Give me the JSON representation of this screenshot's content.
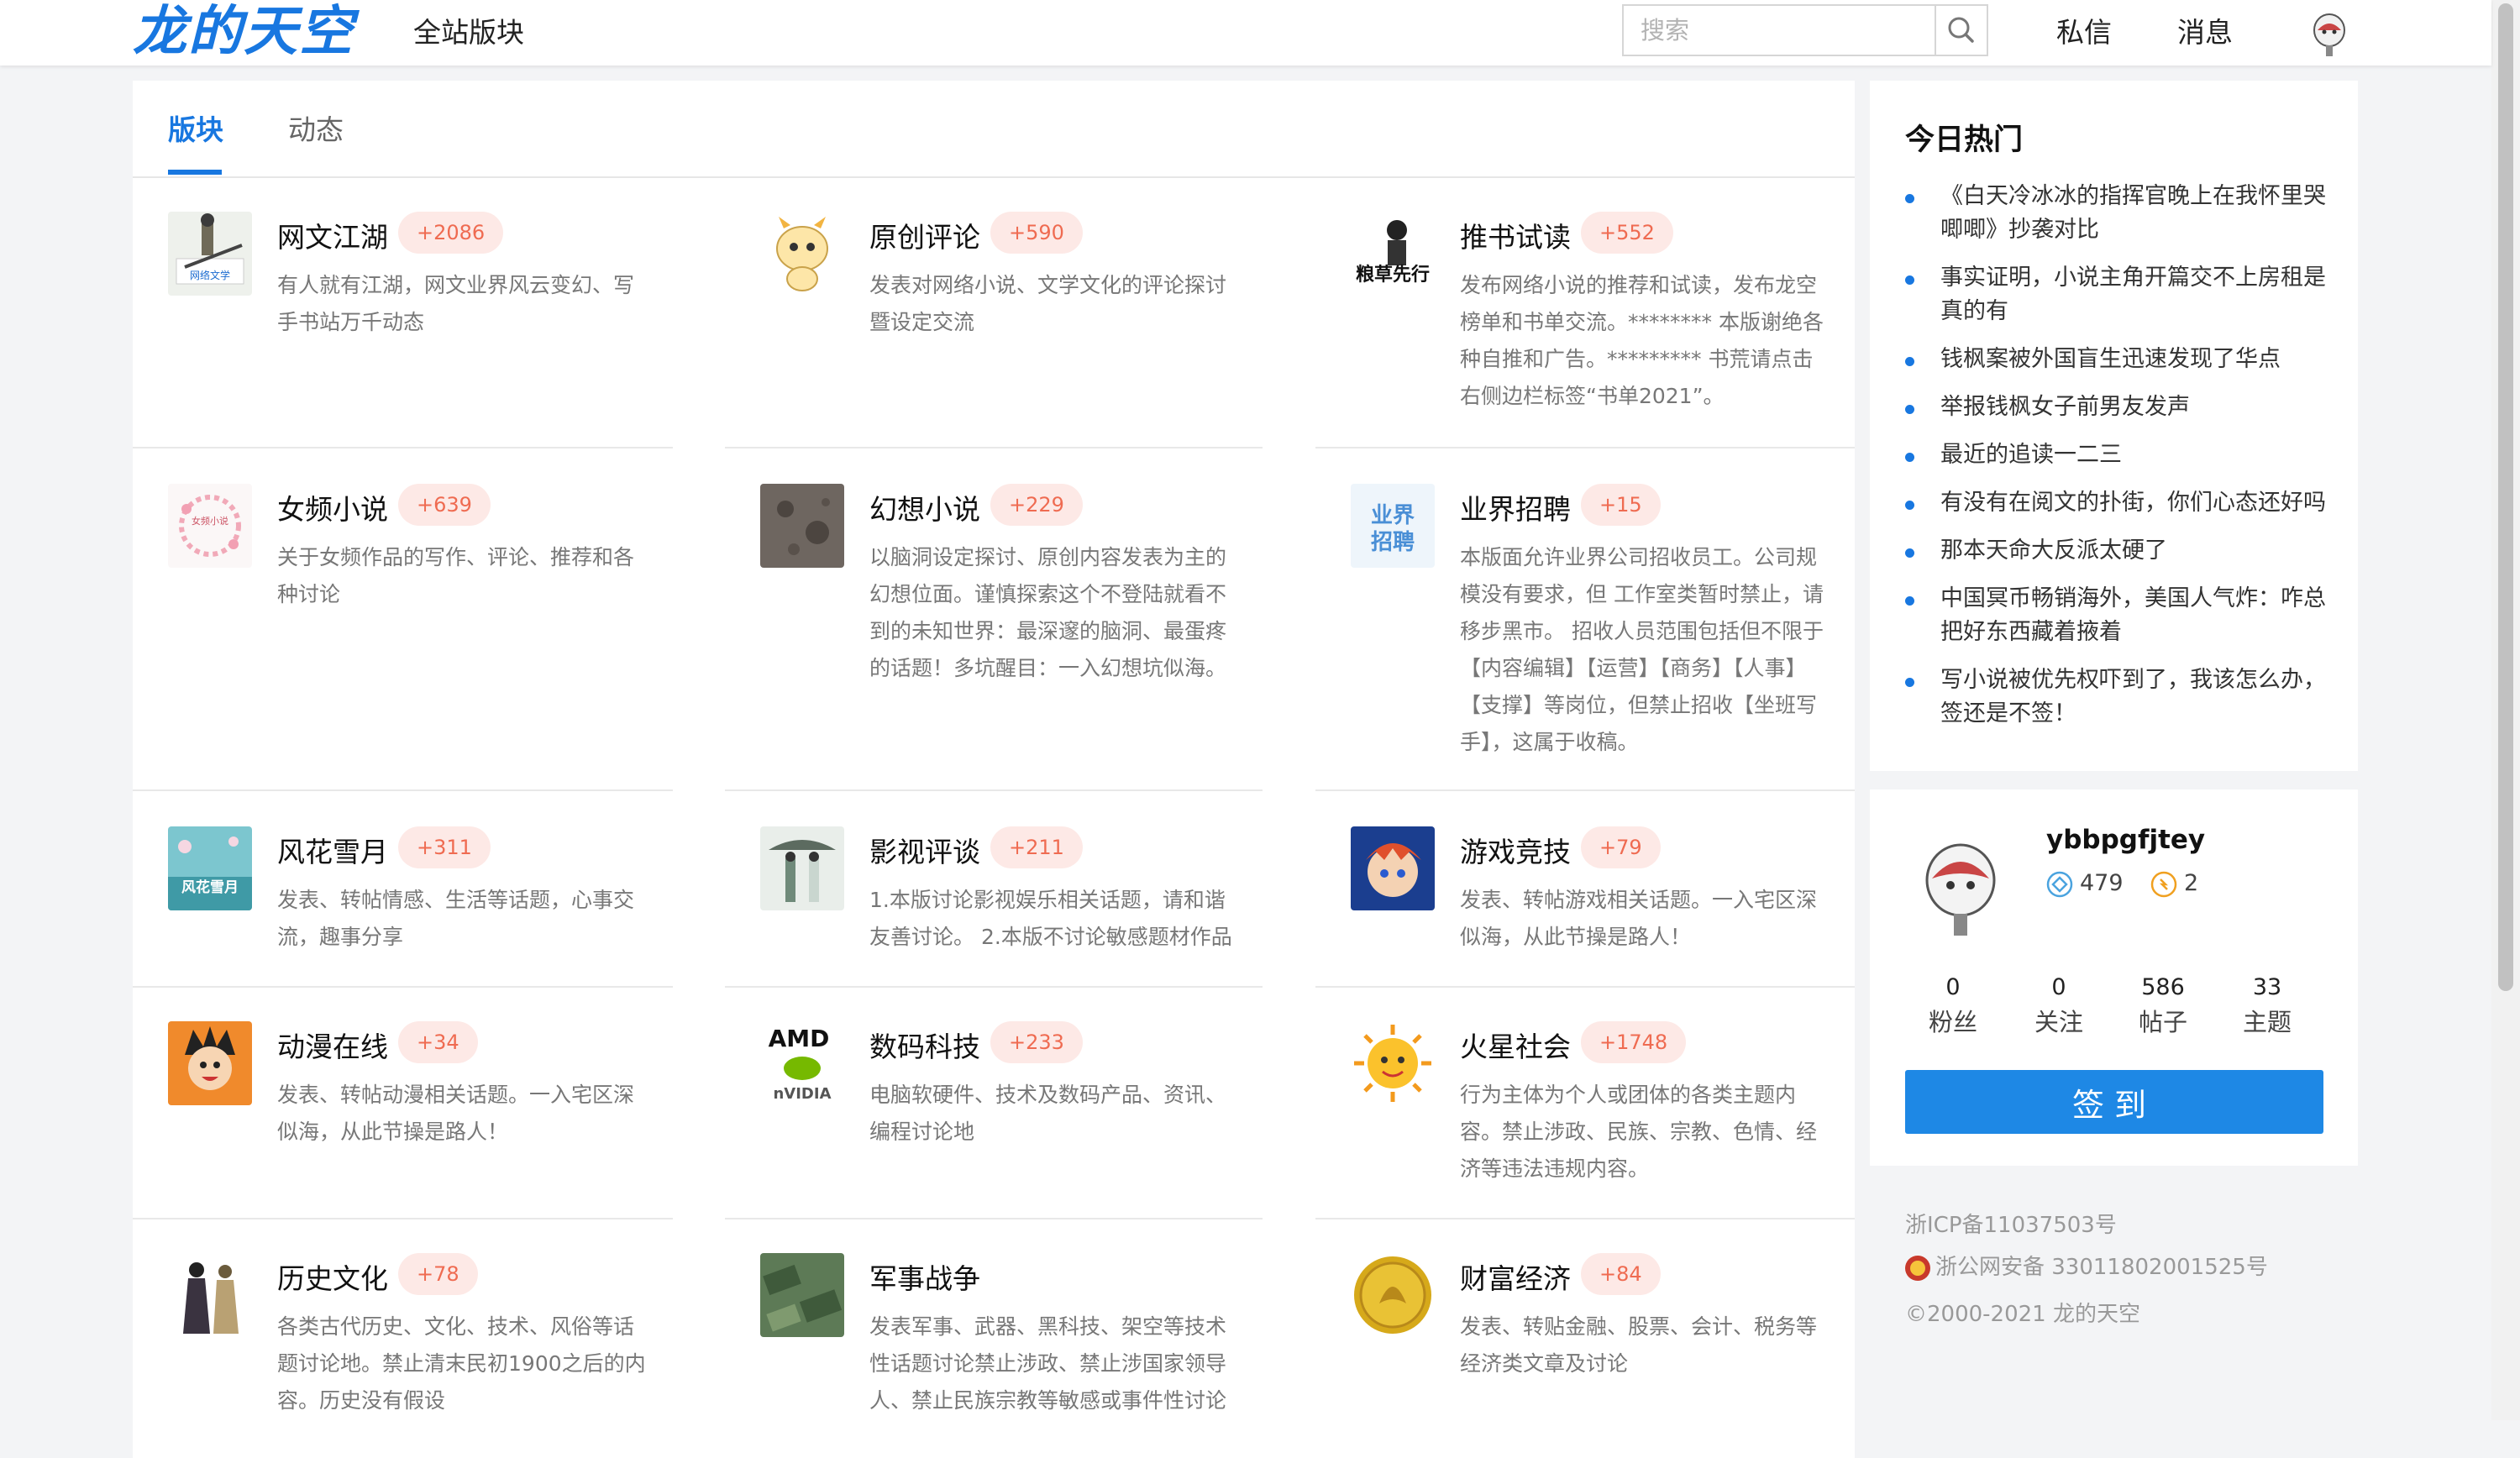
{
  "header": {
    "logo": "龙的天空",
    "nav_all": "全站版块",
    "search_placeholder": "搜索",
    "messages_private": "私信",
    "messages": "消息"
  },
  "tabs": [
    "版块",
    "动态"
  ],
  "boards": [
    {
      "name": "网文江湖",
      "count": "+2086",
      "desc": "有人就有江湖，网文业界风云变幻、写手书站万千动态"
    },
    {
      "name": "原创评论",
      "count": "+590",
      "desc": "发表对网络小说、文学文化的评论探讨暨设定交流"
    },
    {
      "name": "推书试读",
      "count": "+552",
      "desc": "发布网络小说的推荐和试读，发布龙空榜单和书单交流。******** 本版谢绝各种自推和广告。********* 书荒请点击右侧边栏标签“书单2021”。"
    },
    {
      "name": "女频小说",
      "count": "+639",
      "desc": "关于女频作品的写作、评论、推荐和各种讨论"
    },
    {
      "name": "幻想小说",
      "count": "+229",
      "desc": "以脑洞设定探讨、原创内容发表为主的幻想位面。谨慎探索这个不登陆就看不到的未知世界：最深邃的脑洞、最蛋疼的话题！多坑醒目：一入幻想坑似海。"
    },
    {
      "name": "业界招聘",
      "count": "+15",
      "desc": "本版面允许业界公司招收员工。公司规模没有要求，但 工作室类暂时禁止，请移步黑市。 招收人员范围包括但不限于【内容编辑】【运营】【商务】【人事】【支撑】等岗位，但禁止招收【坐班写手】，这属于收稿。"
    },
    {
      "name": "风花雪月",
      "count": "+311",
      "desc": "发表、转帖情感、生活等话题，心事交流，趣事分享"
    },
    {
      "name": "影视评谈",
      "count": "+211",
      "desc": "1.本版讨论影视娱乐相关话题，请和谐友善讨论。 2.本版不讨论敏感题材作品"
    },
    {
      "name": "游戏竞技",
      "count": "+79",
      "desc": "发表、转帖游戏相关话题。一入宅区深似海，从此节操是路人！"
    },
    {
      "name": "动漫在线",
      "count": "+34",
      "desc": "发表、转帖动漫相关话题。一入宅区深似海，从此节操是路人！"
    },
    {
      "name": "数码科技",
      "count": "+233",
      "desc": "电脑软硬件、技术及数码产品、资讯、编程讨论地"
    },
    {
      "name": "火星社会",
      "count": "+1748",
      "desc": "行为主体为个人或团体的各类主题内容。禁止涉政、民族、宗教、色情、经济等违法违规内容。"
    },
    {
      "name": "历史文化",
      "count": "+78",
      "desc": "各类古代历史、文化、技术、风俗等话题讨论地。禁止清末民初1900之后的内容。历史没有假设"
    },
    {
      "name": "军事战争",
      "count": "",
      "desc": "发表军事、武器、黑科技、架空等技术性话题讨论禁止涉政、禁止涉国家领导人、禁止民族宗教等敏感或事件性讨论"
    },
    {
      "name": "财富经济",
      "count": "+84",
      "desc": "发表、转贴金融、股票、会计、税务等经济类文章及讨论"
    }
  ],
  "hot": {
    "title": "今日热门",
    "items": [
      "《白天冷冰冰的指挥官晚上在我怀里哭唧唧》抄袭对比",
      "事实证明，小说主角开篇交不上房租是真的有",
      "钱枫案被外国盲生迅速发现了华点",
      "举报钱枫女子前男友发声",
      "最近的追读一二三",
      "有没有在阅文的扑街，你们心态还好吗",
      "那本天命大反派太硬了",
      "中国冥币畅销海外，美国人气炸：咋总把好东西藏着掖着",
      "写小说被优先权吓到了，我该怎么办，签还是不签！"
    ]
  },
  "user": {
    "name": "ybbpgfjtey",
    "diamonds": "479",
    "coins": "2",
    "counts": [
      {
        "num": "0",
        "label": "粉丝"
      },
      {
        "num": "0",
        "label": "关注"
      },
      {
        "num": "586",
        "label": "帖子"
      },
      {
        "num": "33",
        "label": "主题"
      }
    ],
    "signin": "签到"
  },
  "footer": {
    "icp": "浙ICP备11037503号",
    "police": "浙公网安备 33011802001525号",
    "copyright": "©2000-2021 龙的天空"
  },
  "colors": {
    "accent": "#1877e0",
    "badge_text": "#ef6b51",
    "badge_bg": "#fde9e6"
  }
}
